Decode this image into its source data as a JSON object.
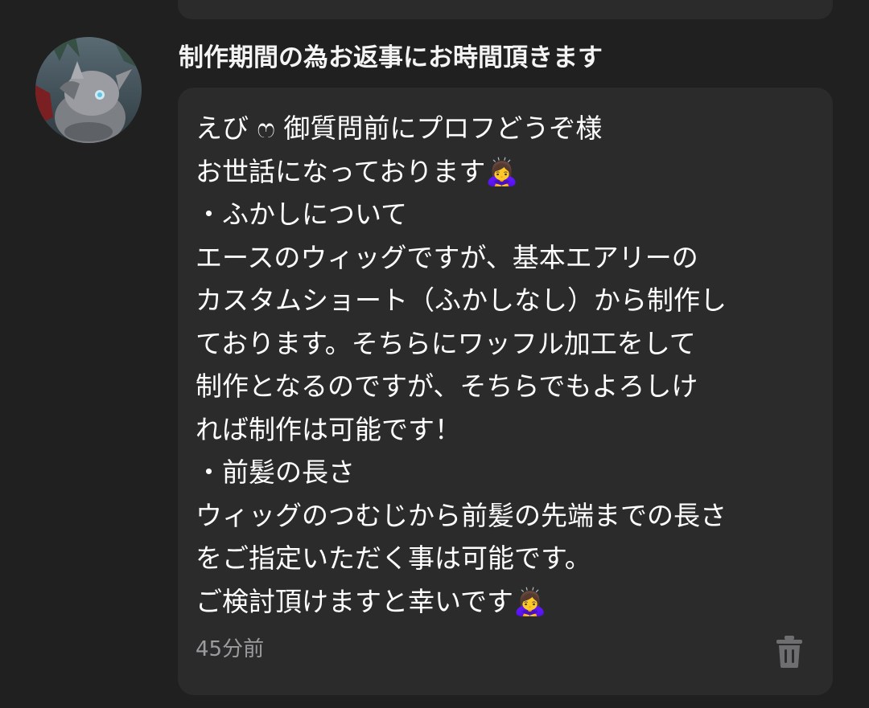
{
  "sender": {
    "name": "制作期間の為お返事にお時間頂きます"
  },
  "message": {
    "lines": [
      "えび ෆ 御質問前にプロフどうぞ様",
      "お世話になっております🙇‍♀️",
      "・ふかしについて",
      "エースのウィッグですが、基本エアリーの",
      "カスタムショート（ふかしなし）から制作し",
      "ております。そちらにワッフル加工をして",
      "制作となるのですが、そちらでもよろしけ",
      "れば制作は可能です！",
      "・前髪の長さ",
      "ウィッグのつむじから前髪の先端までの長さ",
      "をご指定いただく事は可能です。",
      "ご検討頂けますと幸いです🙇‍♀️"
    ],
    "timestamp": "45分前"
  },
  "icons": {
    "delete": "trash-icon",
    "avatar": "user-avatar-image"
  },
  "colors": {
    "background": "#202021",
    "bubble": "#2b2b2c",
    "text": "#ffffff",
    "muted": "#9c9c9e"
  }
}
